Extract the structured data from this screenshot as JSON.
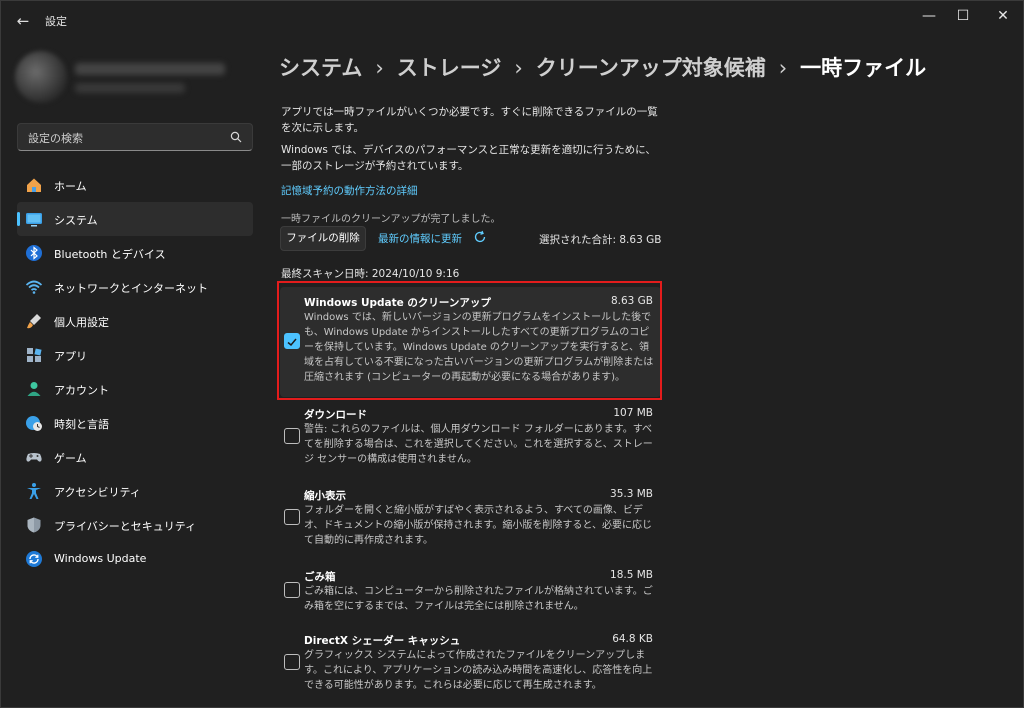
{
  "window": {
    "title": "設定",
    "back_label": "←",
    "minimize_label": "—",
    "maximize_label": "☐",
    "close_label": "✕"
  },
  "search": {
    "placeholder": "設定の検索"
  },
  "sidebar": {
    "items": [
      {
        "label": "ホーム",
        "icon": "home-icon",
        "active": false
      },
      {
        "label": "システム",
        "icon": "system-icon",
        "active": true
      },
      {
        "label": "Bluetooth とデバイス",
        "icon": "bluetooth-icon",
        "active": false
      },
      {
        "label": "ネットワークとインターネット",
        "icon": "wifi-icon",
        "active": false
      },
      {
        "label": "個人用設定",
        "icon": "brush-icon",
        "active": false
      },
      {
        "label": "アプリ",
        "icon": "apps-icon",
        "active": false
      },
      {
        "label": "アカウント",
        "icon": "account-icon",
        "active": false
      },
      {
        "label": "時刻と言語",
        "icon": "globe-clock-icon",
        "active": false
      },
      {
        "label": "ゲーム",
        "icon": "gamepad-icon",
        "active": false
      },
      {
        "label": "アクセシビリティ",
        "icon": "accessibility-icon",
        "active": false
      },
      {
        "label": "プライバシーとセキュリティ",
        "icon": "shield-icon",
        "active": false
      },
      {
        "label": "Windows Update",
        "icon": "update-icon",
        "active": false
      }
    ]
  },
  "breadcrumb": {
    "items": [
      "システム",
      "ストレージ",
      "クリーンアップ対象候補"
    ],
    "current": "一時ファイル",
    "separator": "›"
  },
  "main": {
    "intro": "アプリでは一時ファイルがいくつか必要です。すぐに削除できるファイルの一覧を次に示します。",
    "reserved": "Windows では、デバイスのパフォーマンスと正常な更新を適切に行うために、一部のストレージが予約されています。",
    "learn_more_link": "記憶域予約の動作方法の詳細",
    "cleanup_done": "一時ファイルのクリーンアップが完了しました。",
    "delete_button": "ファイルの削除",
    "refresh_link": "最新の情報に更新",
    "selected_total": "選択された合計: 8.63 GB",
    "last_scan": "最終スキャン日時: 2024/10/10 9:16"
  },
  "files": [
    {
      "title": "Windows Update のクリーンアップ",
      "size": "8.63 GB",
      "checked": true,
      "desc": "Windows では、新しいバージョンの更新プログラムをインストールした後でも、Windows Update からインストールしたすべての更新プログラムのコピーを保持しています。Windows Update のクリーンアップを実行すると、領域を占有している不要になった古いバージョンの更新プログラムが削除または圧縮されます (コンピューターの再起動が必要になる場合があります)。"
    },
    {
      "title": "ダウンロード",
      "size": "107 MB",
      "checked": false,
      "desc": "警告: これらのファイルは、個人用ダウンロード フォルダーにあります。すべてを削除する場合は、これを選択してください。これを選択すると、ストレージ センサーの構成は使用されません。"
    },
    {
      "title": "縮小表示",
      "size": "35.3 MB",
      "checked": false,
      "desc": "フォルダーを開くと縮小版がすばやく表示されるよう、すべての画像、ビデオ、ドキュメントの縮小版が保持されます。縮小版を削除すると、必要に応じて自動的に再作成されます。"
    },
    {
      "title": "ごみ箱",
      "size": "18.5 MB",
      "checked": false,
      "desc": "ごみ箱には、コンピューターから削除されたファイルが格納されています。ごみ箱を空にするまでは、ファイルは完全には削除されません。"
    },
    {
      "title": "DirectX シェーダー キャッシュ",
      "size": "64.8 KB",
      "checked": false,
      "desc": "グラフィックス システムによって作成されたファイルをクリーンアップします。これにより、アプリケーションの読み込み時間を高速化し、応答性を向上できる可能性があります。これらは必要に応じて再生成されます。"
    }
  ],
  "colors": {
    "accent": "#4cc2ff",
    "link": "#60cdff",
    "highlight_border": "#e31c1c",
    "background": "#202020"
  }
}
